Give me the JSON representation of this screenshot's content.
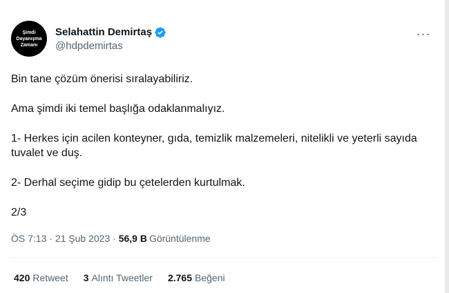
{
  "author": {
    "avatar_lines": [
      "Şimdi",
      "Dayanışma",
      "Zamanı"
    ],
    "display_name": "Selahattin Demirtaş",
    "handle": "@hdpdemirtas",
    "verified_color": "#1d9bf0"
  },
  "more_icon": "···",
  "tweet": {
    "paragraphs": [
      "Bin tane çözüm önerisi sıralayabiliriz.",
      "Ama şimdi iki temel başlığa odaklanmalıyız.",
      "1- Herkes için acilen konteyner, gıda, temizlik malzemeleri, nitelikli ve yeterli sayıda tuvalet ve duş.",
      "2- Derhal seçime gidip bu çetelerden kurtulmak.",
      "2/3"
    ]
  },
  "meta": {
    "time": "ÖS 7:13",
    "separator": " · ",
    "date": "21 Şub 2023",
    "separator2": " · ",
    "views_count": "56,9 B",
    "views_label": "Görüntülenme"
  },
  "stats": {
    "retweets_count": "420",
    "retweets_label": "Retweet",
    "quotes_count": "3",
    "quotes_label": "Alıntı Tweetler",
    "likes_count": "2.765",
    "likes_label": "Beğeni"
  }
}
